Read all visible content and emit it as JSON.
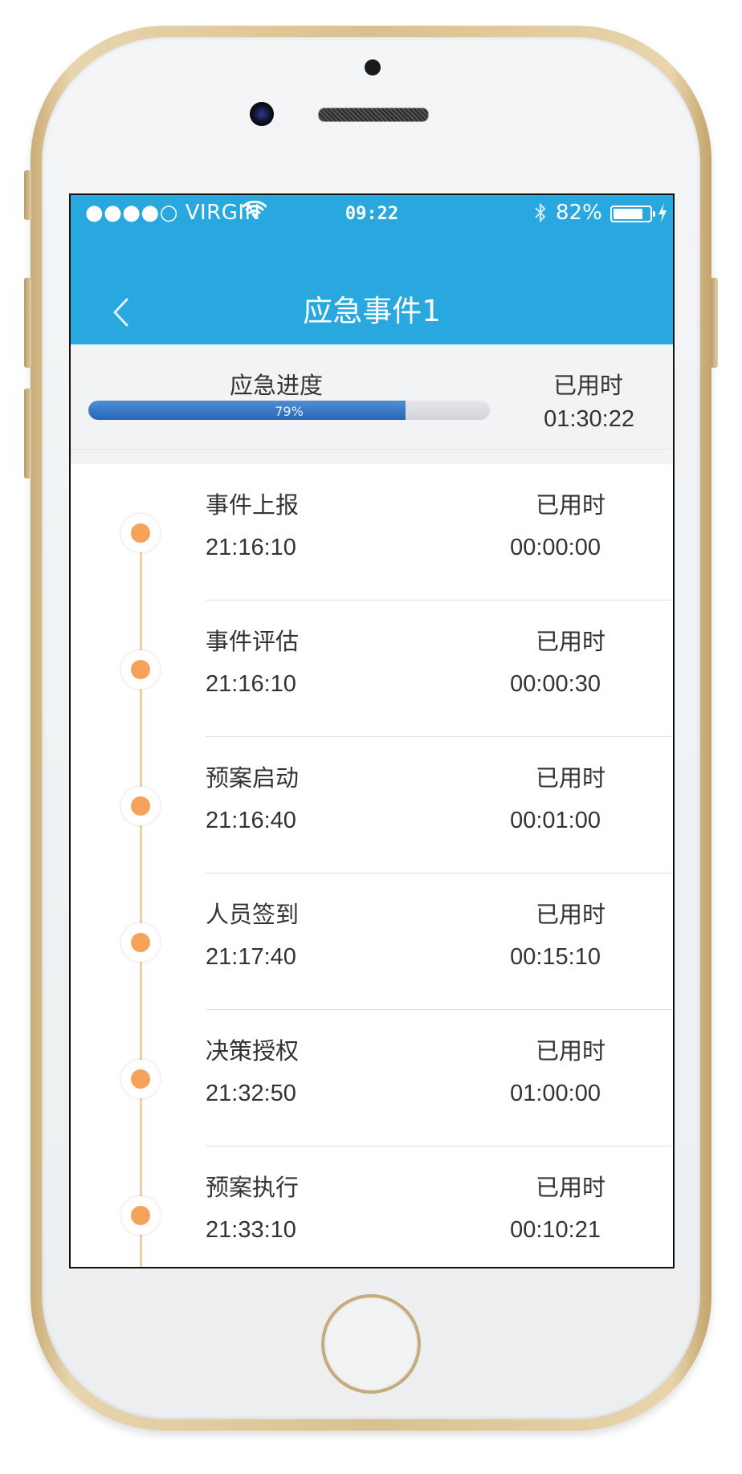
{
  "status_bar": {
    "carrier": "●●●●○ VIRGIN",
    "time": "09:22",
    "battery_percent": "82%",
    "battery_level": 0.82,
    "icons": [
      "wifi-icon",
      "bluetooth-icon",
      "battery-icon",
      "charging-icon"
    ]
  },
  "nav": {
    "title": "应急事件1",
    "back_icon": "chevron-left-icon"
  },
  "progress": {
    "label": "应急进度",
    "percent_text": "79%",
    "value": 0.79,
    "used_label": "已用时",
    "used_time": "01:30:22"
  },
  "steps": [
    {
      "name": "事件上报",
      "time": "21:16:10",
      "used_label": "已用时",
      "used_time": "00:00:00"
    },
    {
      "name": "事件评估",
      "time": "21:16:10",
      "used_label": "已用时",
      "used_time": "00:00:30"
    },
    {
      "name": "预案启动",
      "time": "21:16:40",
      "used_label": "已用时",
      "used_time": "00:01:00"
    },
    {
      "name": "人员签到",
      "time": "21:17:40",
      "used_label": "已用时",
      "used_time": "00:15:10"
    },
    {
      "name": "决策授权",
      "time": "21:32:50",
      "used_label": "已用时",
      "used_time": "01:00:00"
    },
    {
      "name": "预案执行",
      "time": "21:33:10",
      "used_label": "已用时",
      "used_time": "00:10:21"
    }
  ],
  "colors": {
    "header": "#29a8df",
    "progress_fill": "#2866b7",
    "timeline_dot": "#f7a25a",
    "timeline_line": "#f1cfaa"
  }
}
